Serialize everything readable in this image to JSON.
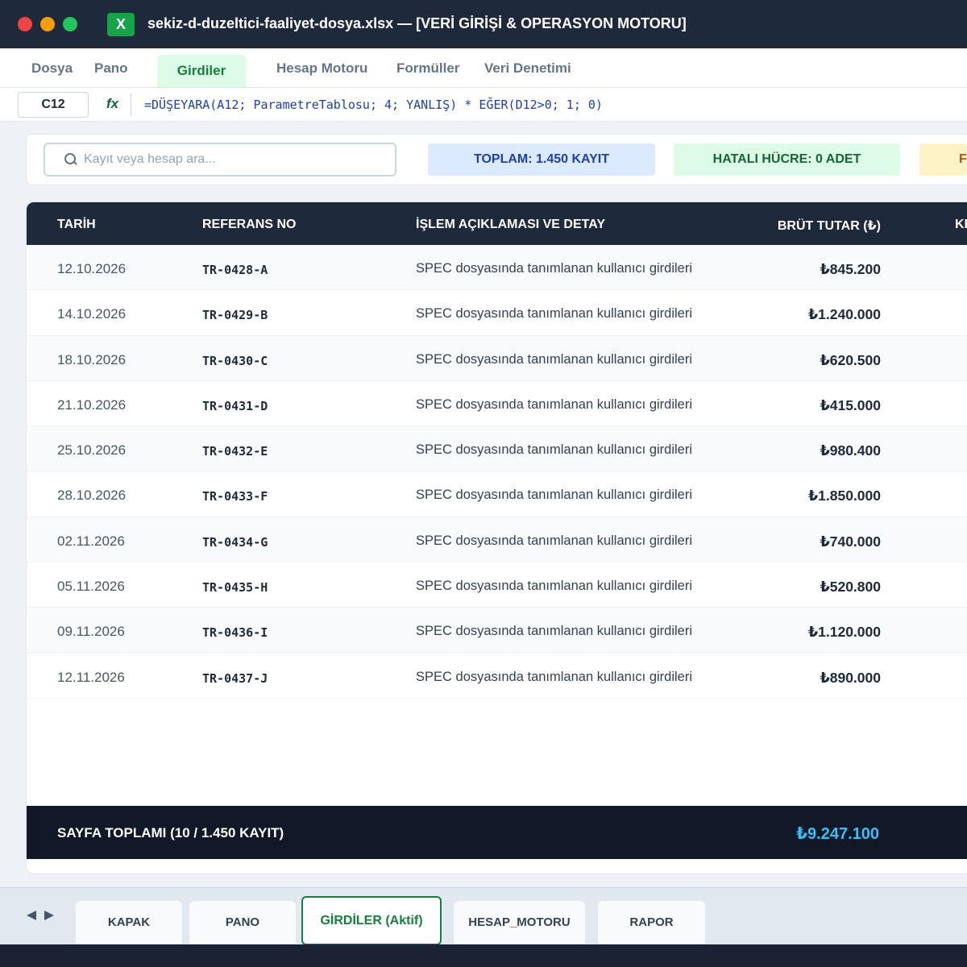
{
  "window": {
    "title": "sekiz-d-duzeltici-faaliyet-dosya.xlsx — [VERİ GİRİŞİ & OPERASYON MOTORU]",
    "app_icon_letter": "X"
  },
  "menu": {
    "items": [
      "Dosya",
      "Pano",
      "Girdiler",
      "Hesap Motoru",
      "Formüller",
      "Veri Denetimi"
    ],
    "active": "Girdiler"
  },
  "formula_bar": {
    "cell_ref": "C12",
    "fx_label": "fx",
    "formula": "=DÜŞEYARA(A12; ParametreTablosu; 4; YANLIŞ) * EĞER(D12>0; 1; 0)"
  },
  "search": {
    "placeholder": "Kayıt veya hesap ara..."
  },
  "badges": {
    "total": "TOPLAM: 1.450 KAYIT",
    "errors": "HATALI HÜCRE: 0 ADET",
    "third": "F"
  },
  "table": {
    "columns": [
      "TARİH",
      "REFERANS NO",
      "İŞLEM AÇIKLAMASI VE DETAY",
      "BRÜT TUTAR (₺)",
      "KI"
    ],
    "rows": [
      {
        "date": "12.10.2026",
        "ref": "TR-0428-A",
        "desc": "SPEC dosyasında tanımlanan kullanıcı girdileri",
        "amount": "₺845.200"
      },
      {
        "date": "14.10.2026",
        "ref": "TR-0429-B",
        "desc": "SPEC dosyasında tanımlanan kullanıcı girdileri",
        "amount": "₺1.240.000"
      },
      {
        "date": "18.10.2026",
        "ref": "TR-0430-C",
        "desc": "SPEC dosyasında tanımlanan kullanıcı girdileri",
        "amount": "₺620.500"
      },
      {
        "date": "21.10.2026",
        "ref": "TR-0431-D",
        "desc": "SPEC dosyasında tanımlanan kullanıcı girdileri",
        "amount": "₺415.000"
      },
      {
        "date": "25.10.2026",
        "ref": "TR-0432-E",
        "desc": "SPEC dosyasında tanımlanan kullanıcı girdileri",
        "amount": "₺980.400"
      },
      {
        "date": "28.10.2026",
        "ref": "TR-0433-F",
        "desc": "SPEC dosyasında tanımlanan kullanıcı girdileri",
        "amount": "₺1.850.000"
      },
      {
        "date": "02.11.2026",
        "ref": "TR-0434-G",
        "desc": "SPEC dosyasında tanımlanan kullanıcı girdileri",
        "amount": "₺740.000"
      },
      {
        "date": "05.11.2026",
        "ref": "TR-0435-H",
        "desc": "SPEC dosyasında tanımlanan kullanıcı girdileri",
        "amount": "₺520.800"
      },
      {
        "date": "09.11.2026",
        "ref": "TR-0436-I",
        "desc": "SPEC dosyasında tanımlanan kullanıcı girdileri",
        "amount": "₺1.120.000"
      },
      {
        "date": "12.11.2026",
        "ref": "TR-0437-J",
        "desc": "SPEC dosyasında tanımlanan kullanıcı girdileri",
        "amount": "₺890.000"
      }
    ],
    "footer": {
      "label": "SAYFA TOPLAMI (10 / 1.450 KAYIT)",
      "total": "₺9.247.100"
    }
  },
  "sheets": {
    "tabs": [
      "KAPAK",
      "PANO",
      "GİRDİLER (Aktif)",
      "HESAP_MOTORU",
      "RAPOR"
    ],
    "active_index": 2
  },
  "colors": {
    "titlebar": "#1e293b",
    "accent_green": "#15803d",
    "total_blue": "#38bdf8"
  }
}
